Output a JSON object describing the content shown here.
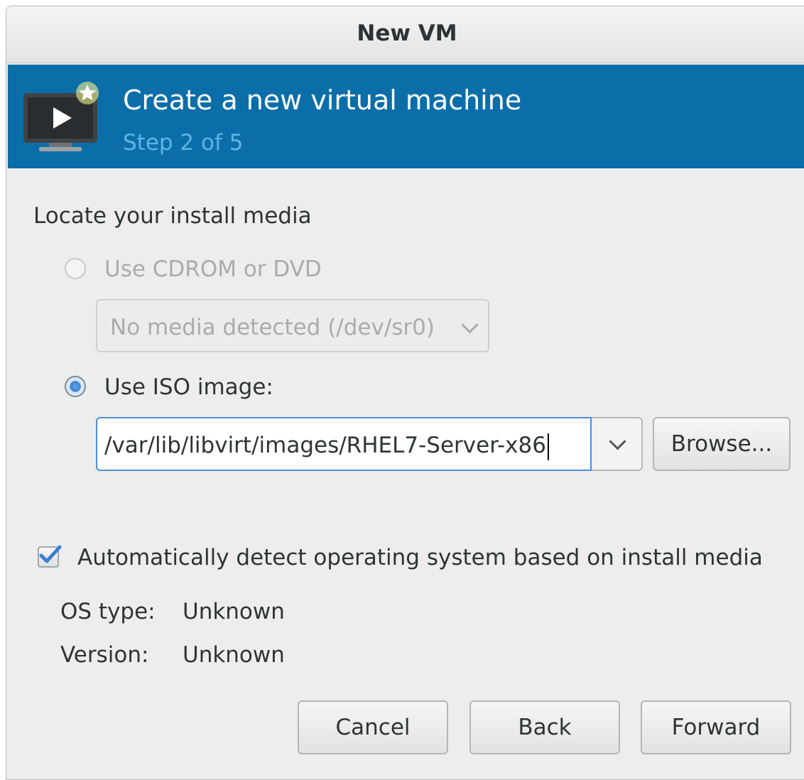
{
  "window": {
    "title": "New VM"
  },
  "banner": {
    "title": "Create a new virtual machine",
    "step": "Step 2 of 5",
    "bg_color": "#0b6ea9",
    "icon": "monitor-play-new-icon"
  },
  "media": {
    "heading": "Locate your install media",
    "cdrom_option": {
      "label": "Use CDROM or DVD",
      "selected": false,
      "enabled": false
    },
    "cdrom_device": {
      "value": "No media detected (/dev/sr0)",
      "enabled": false
    },
    "iso_option": {
      "label": "Use ISO image:",
      "selected": true
    },
    "iso_path": "/var/lib/libvirt/images/RHEL7-Server-x86",
    "browse_label": "Browse..."
  },
  "os_detect": {
    "label": "Automatically detect operating system based on install media",
    "checked": true,
    "os_type_label": "OS type:",
    "os_type_value": "Unknown",
    "version_label": "Version:",
    "version_value": "Unknown"
  },
  "buttons": {
    "cancel": "Cancel",
    "back": "Back",
    "forward": "Forward"
  }
}
